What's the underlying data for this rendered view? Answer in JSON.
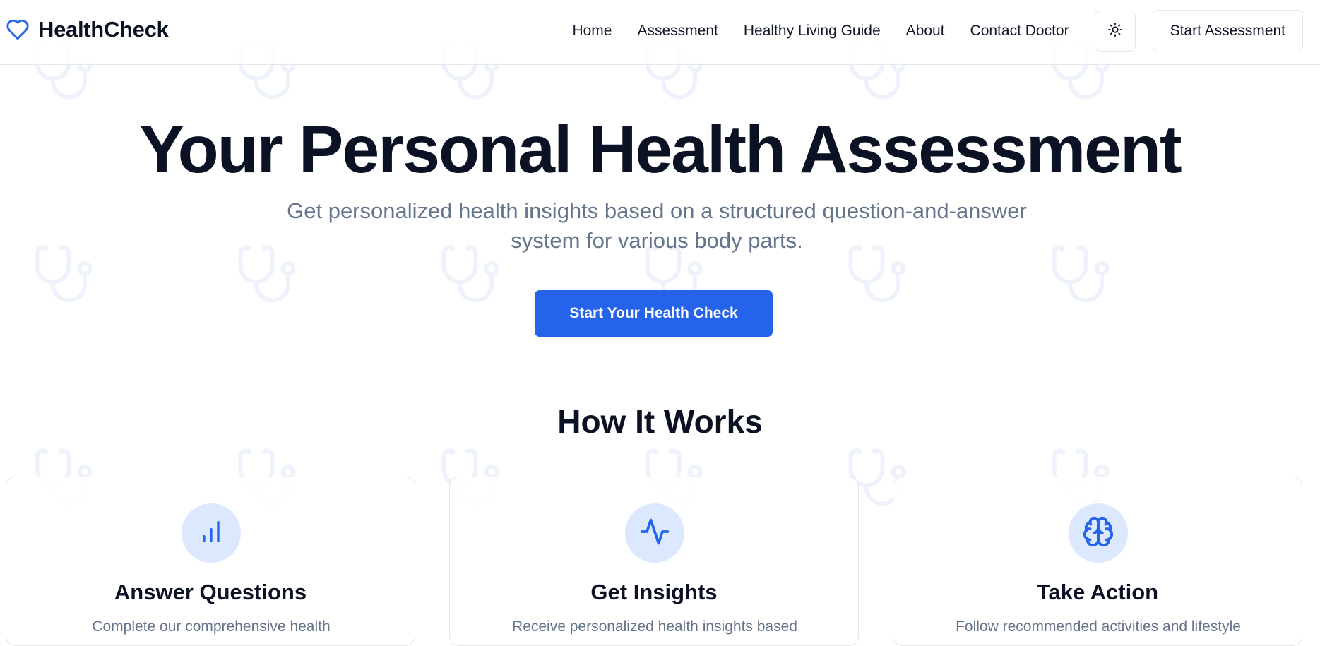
{
  "colors": {
    "accent": "#2563eb",
    "icon_bg": "#dbe8fe",
    "text_dark": "#0b1224",
    "text_muted": "#64748b",
    "border": "#e5e7eb"
  },
  "header": {
    "brand_icon": "heart-icon",
    "brand_name": "HealthCheck",
    "nav": [
      {
        "label": "Home"
      },
      {
        "label": "Assessment"
      },
      {
        "label": "Healthy Living Guide"
      },
      {
        "label": "About"
      },
      {
        "label": "Contact Doctor"
      }
    ],
    "theme_toggle_icon": "sun-icon",
    "cta_label": "Start Assessment"
  },
  "hero": {
    "title": "Your Personal Health Assessment",
    "subtitle": "Get personalized health insights based on a structured question-and-answer system for various body parts.",
    "cta_label": "Start Your Health Check"
  },
  "how_it_works": {
    "title": "How It Works",
    "cards": [
      {
        "icon": "bar-chart-icon",
        "title": "Answer Questions",
        "description": "Complete our comprehensive health"
      },
      {
        "icon": "activity-icon",
        "title": "Get Insights",
        "description": "Receive personalized health insights based"
      },
      {
        "icon": "brain-icon",
        "title": "Take Action",
        "description": "Follow recommended activities and lifestyle"
      }
    ]
  }
}
